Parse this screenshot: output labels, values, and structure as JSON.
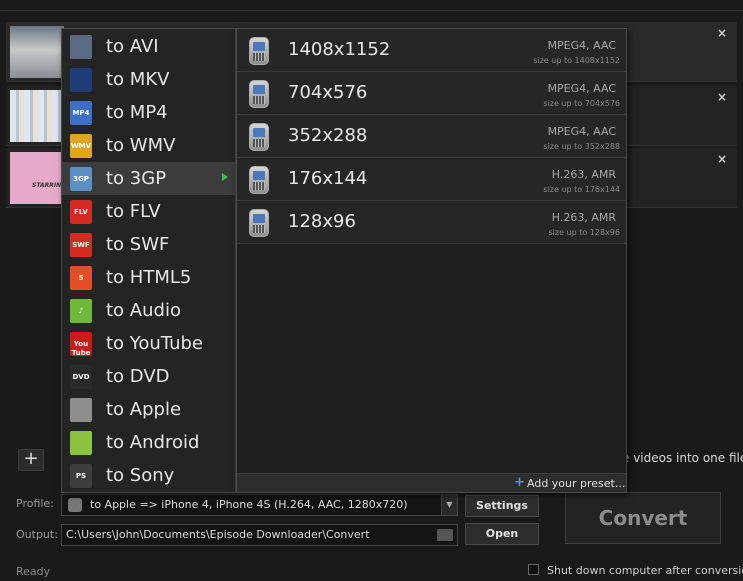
{
  "file_list": {
    "close_glyph": "×",
    "rows": [
      {
        "thumb_text": ""
      },
      {
        "thumb_text": ""
      },
      {
        "thumb_text": "STARRIN"
      }
    ]
  },
  "add_button": {
    "label": "+"
  },
  "merge_option_text": "e videos into one file",
  "profile": {
    "label": "Profile:",
    "value": "to Apple => iPhone 4, iPhone 4S (H.264, AAC, 1280x720)"
  },
  "output": {
    "label": "Output:",
    "value": "C:\\Users\\John\\Documents\\Episode Downloader\\Convert"
  },
  "buttons": {
    "settings": "Settings",
    "open": "Open",
    "convert": "Convert"
  },
  "status": "Ready",
  "shutdown_label": "Shut down computer after conversion",
  "format_menu": {
    "items": [
      {
        "label": "to AVI",
        "icon": "avi-icon",
        "icon_text": "",
        "color": "#5a6b82"
      },
      {
        "label": "to MKV",
        "icon": "mkv-icon",
        "icon_text": "",
        "color": "#1e3c78"
      },
      {
        "label": "to MP4",
        "icon": "mp4-icon",
        "icon_text": "MP4",
        "color": "#3b6fc8"
      },
      {
        "label": "to WMV",
        "icon": "wmv-icon",
        "icon_text": "WMV",
        "color": "#e0a423"
      },
      {
        "label": "to 3GP",
        "icon": "3gp-icon",
        "icon_text": "3GP",
        "color": "#5c8fc4",
        "selected": true
      },
      {
        "label": "to FLV",
        "icon": "flv-icon",
        "icon_text": "FLV",
        "color": "#d42a1f"
      },
      {
        "label": "to SWF",
        "icon": "swf-icon",
        "icon_text": "SWF",
        "color": "#d42a1f"
      },
      {
        "label": "to HTML5",
        "icon": "html5-icon",
        "icon_text": "5",
        "color": "#e44d26"
      },
      {
        "label": "to Audio",
        "icon": "audio-icon",
        "icon_text": "♪",
        "color": "#6fb83a"
      },
      {
        "label": "to YouTube",
        "icon": "youtube-icon",
        "icon_text": "You Tube",
        "color": "#cc1b1b"
      },
      {
        "label": "to DVD",
        "icon": "dvd-icon",
        "icon_text": "DVD",
        "color": "#2a2a2a"
      },
      {
        "label": "to Apple",
        "icon": "apple-icon",
        "icon_text": "",
        "color": "#8e8e8e"
      },
      {
        "label": "to Android",
        "icon": "android-icon",
        "icon_text": "",
        "color": "#8ac43f"
      },
      {
        "label": "to Sony",
        "icon": "playstation-icon",
        "icon_text": "PS",
        "color": "#3c3c3c"
      }
    ]
  },
  "submenu": {
    "items": [
      {
        "resolution": "1408x1152",
        "codec": "MPEG4, AAC",
        "size": "size up to 1408x1152"
      },
      {
        "resolution": "704x576",
        "codec": "MPEG4, AAC",
        "size": "size up to 704x576"
      },
      {
        "resolution": "352x288",
        "codec": "MPEG4, AAC",
        "size": "size up to 352x288"
      },
      {
        "resolution": "176x144",
        "codec": "H.263, AMR",
        "size": "size up to 176x144"
      },
      {
        "resolution": "128x96",
        "codec": "H.263, AMR",
        "size": "size up to 128x96"
      }
    ],
    "add_preset": "Add your preset..."
  }
}
